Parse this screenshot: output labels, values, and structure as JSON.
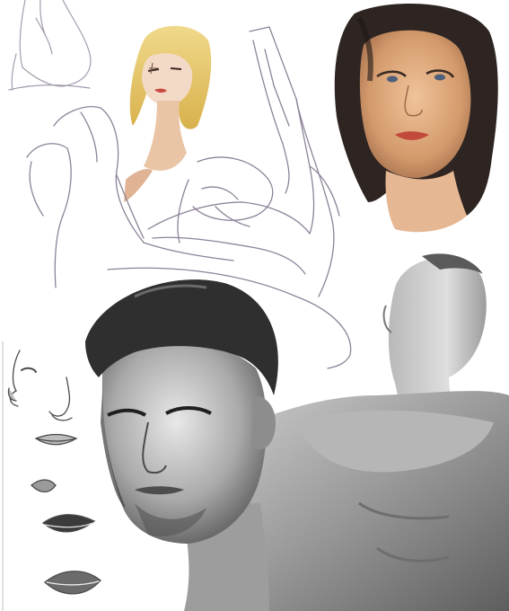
{
  "artwork": {
    "palette": {
      "paper": "#ffffff",
      "sketch_line": "#8c8298",
      "blonde_hair": "#e3c25a",
      "skin_warm": "#d9a77c",
      "skin_pale": "#f1d9c6",
      "dark_hair": "#2b2423",
      "grey_dark": "#3c3c3c",
      "grey_mid": "#8a8a8a",
      "grey_light": "#c8c8c8"
    },
    "studies": [
      {
        "name": "torso-sketch-top-left",
        "kind": "line-sketch"
      },
      {
        "name": "blonde-woman-portrait",
        "kind": "color-painting"
      },
      {
        "name": "raised-arm-sketch",
        "kind": "line-sketch"
      },
      {
        "name": "arms-crossed-sketch",
        "kind": "line-sketch"
      },
      {
        "name": "brunette-woman-portrait",
        "kind": "color-painting"
      },
      {
        "name": "male-portrait",
        "kind": "greyscale-painting"
      },
      {
        "name": "mannequin-figure",
        "kind": "greyscale-painting"
      },
      {
        "name": "feature-studies",
        "kind": "pencil-studies"
      }
    ]
  }
}
